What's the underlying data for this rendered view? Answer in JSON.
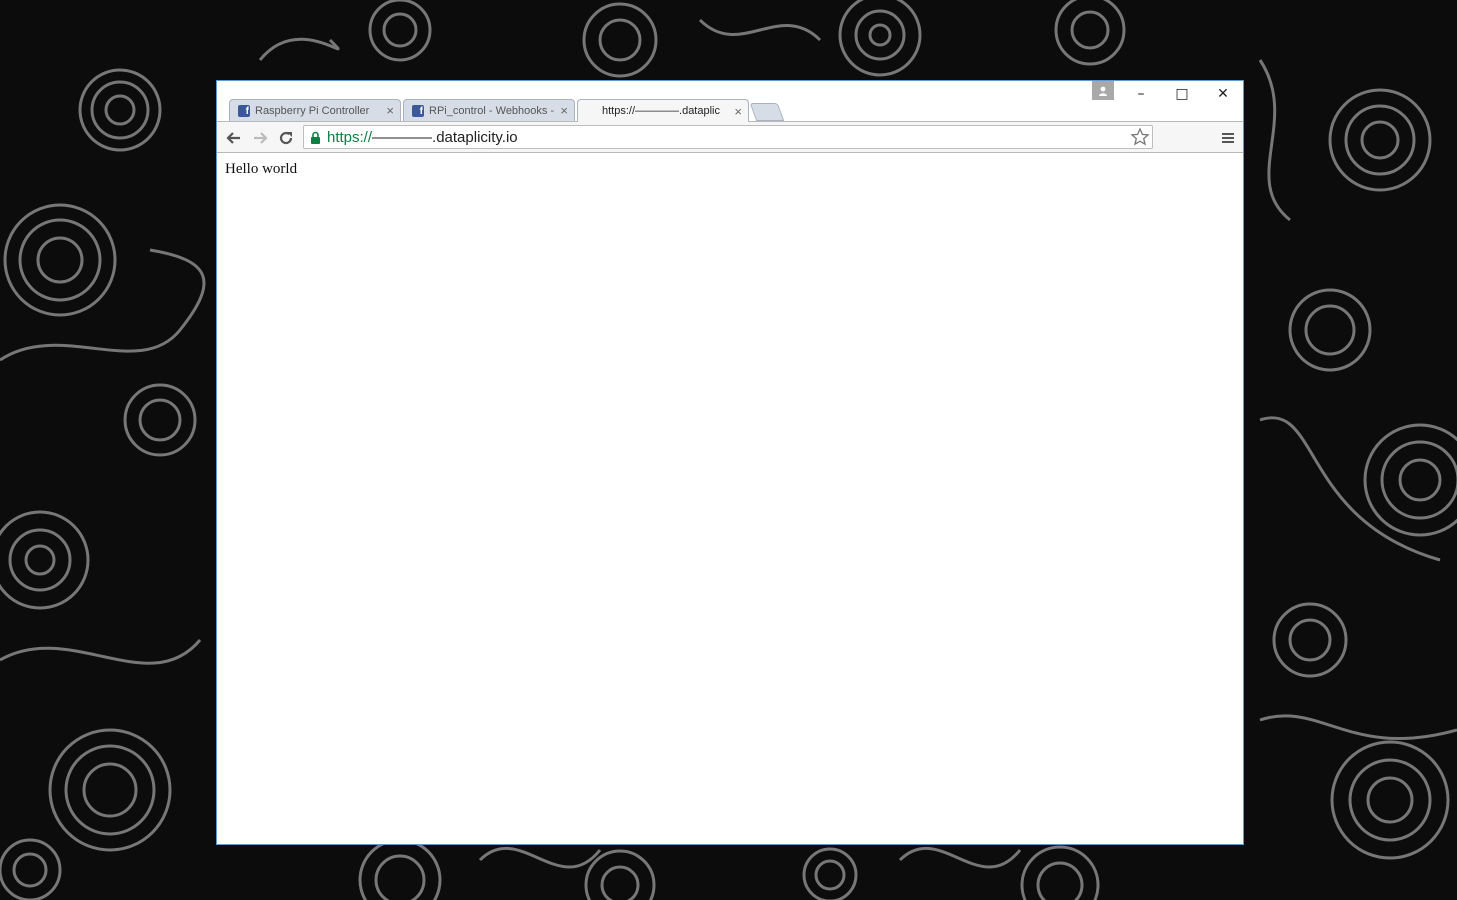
{
  "colors": {
    "desktop_background": "#0c0c0c",
    "wallpaper_pattern": "#8a8a8a",
    "window_border": "#5b9bd5",
    "secure_scheme": "#0b8043",
    "facebook_blue": "#3b5998"
  },
  "tabs": [
    {
      "title": "Raspberry Pi Controller",
      "icon": "facebook-icon",
      "close": "×",
      "active": false
    },
    {
      "title": "RPi_control - Webhooks -",
      "icon": "facebook-icon",
      "close": "×",
      "active": false
    },
    {
      "title": "https://————.dataplic",
      "icon": "",
      "close": "×",
      "active": true
    }
  ],
  "window_controls": {
    "minimize": "–",
    "maximize": "□",
    "close": "✕"
  },
  "toolbar": {
    "back_icon": "back-arrow-icon",
    "forward_icon": "forward-arrow-icon",
    "reload_icon": "reload-icon",
    "url_scheme": "https://",
    "url_rest": "————.dataplicity.io",
    "lock_icon": "lock-icon",
    "bookmark_icon": "star-icon",
    "menu_icon": "hamburger-menu-icon"
  },
  "page": {
    "text": "Hello world"
  }
}
